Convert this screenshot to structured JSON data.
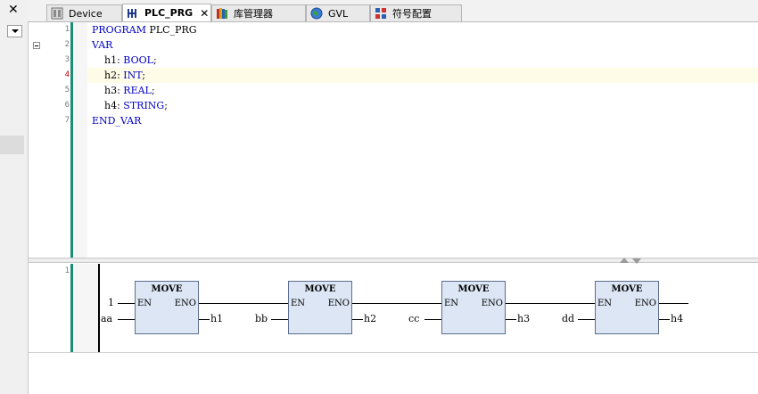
{
  "left_panel": {
    "close_glyph": "✕"
  },
  "tabs": [
    {
      "label": "Device",
      "icon": "device-icon",
      "active": false
    },
    {
      "label": "PLC_PRG",
      "icon": "program-icon",
      "active": true,
      "close": "✕"
    },
    {
      "label": "库管理器",
      "icon": "library-icon",
      "active": false
    },
    {
      "label": "GVL",
      "icon": "globe-icon",
      "active": false
    },
    {
      "label": "符号配置",
      "icon": "symbol-config-icon",
      "active": false
    }
  ],
  "editor": {
    "line_numbers": [
      "1",
      "2",
      "3",
      "4",
      "5",
      "6",
      "7"
    ],
    "lines": [
      {
        "kw": "PROGRAM",
        "rest": " PLC_PRG"
      },
      {
        "kw": "VAR",
        "rest": ""
      },
      {
        "indent": "    ",
        "name": "h1: ",
        "type": "BOOL",
        "semi": ";"
      },
      {
        "indent": "    ",
        "name": "h2: ",
        "type": "INT",
        "semi": ";"
      },
      {
        "indent": "    ",
        "name": "h3: ",
        "type": "REAL",
        "semi": ";"
      },
      {
        "indent": "    ",
        "name": "h4: ",
        "type": "STRING",
        "semi": ";"
      },
      {
        "kw": "END_VAR",
        "rest": ""
      }
    ]
  },
  "network": {
    "number": "1",
    "blocks": [
      {
        "name": "MOVE",
        "en": "EN",
        "eno": "ENO",
        "en_input": "1",
        "input": "aa",
        "output": "h1"
      },
      {
        "name": "MOVE",
        "en": "EN",
        "eno": "ENO",
        "input": "bb",
        "output": "h2"
      },
      {
        "name": "MOVE",
        "en": "EN",
        "eno": "ENO",
        "input": "cc",
        "output": "h3"
      },
      {
        "name": "MOVE",
        "en": "EN",
        "eno": "ENO",
        "input": "dd",
        "output": "h4"
      }
    ]
  },
  "colors": {
    "keyword": "#0000c8",
    "gutter_bar": "#1e8c76",
    "block_fill": "#dce6f4",
    "highlight_line": "#fefce6"
  }
}
